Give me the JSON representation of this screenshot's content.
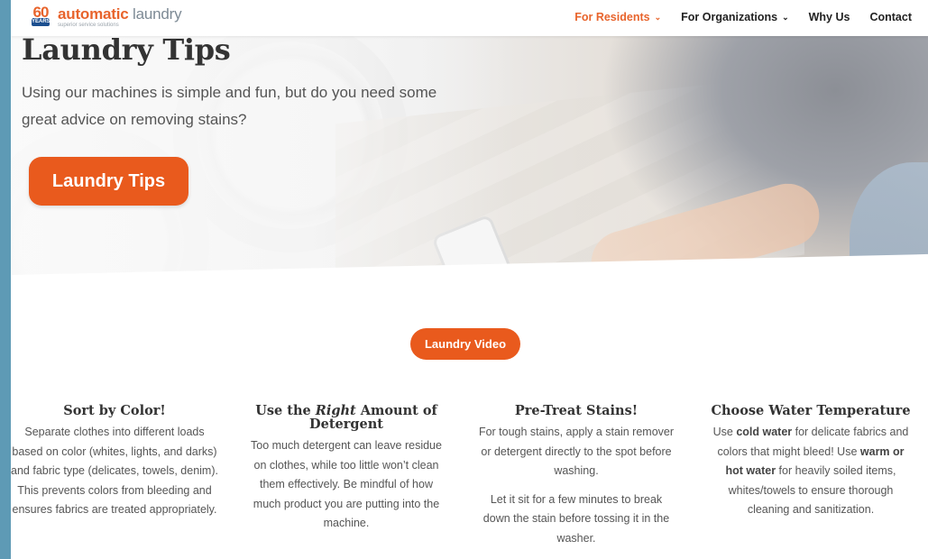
{
  "header": {
    "logo": {
      "badge_number": "60",
      "badge_label": "YEARS",
      "brand_bold": "automatic",
      "brand_light": "laundry",
      "tagline": "superior service solutions"
    },
    "nav": [
      {
        "label": "For Residents",
        "has_dropdown": true,
        "active": true
      },
      {
        "label": "For Organizations",
        "has_dropdown": true,
        "active": false
      },
      {
        "label": "Why Us",
        "has_dropdown": false,
        "active": false
      },
      {
        "label": "Contact",
        "has_dropdown": false,
        "active": false
      }
    ]
  },
  "hero": {
    "title": "Laundry Tips",
    "description": "Using our machines is simple and fun, but do you need some great advice on removing stains?",
    "button_label": "Laundry Tips"
  },
  "video_button_label": "Laundry Video",
  "tips": [
    {
      "title": "Sort by Color!",
      "body": "Separate clothes into different loads based on color (whites, lights, and darks) and fabric type (delicates, towels, denim). This prevents colors from bleeding and ensures fabrics are treated appropriately."
    },
    {
      "title_pre": "Use the ",
      "title_em": "Right",
      "title_post": " Amount of Detergent",
      "body": "Too much detergent can leave residue on clothes, while too little won’t clean them effectively. Be mindful of how much product you are putting into the machine."
    },
    {
      "title": "Pre-Treat Stains!",
      "body": "For tough stains, apply a stain remover or detergent directly to the spot before washing.",
      "body2": "Let it sit for a few minutes to break down the stain before tossing it in the washer."
    },
    {
      "title": "Choose Water Temperature",
      "body_a": "Use ",
      "body_b": "cold water",
      "body_c": " for delicate fabrics and colors that might bleed!  Use ",
      "body_d": "warm or hot water",
      "body_e": " for heavily soiled items, whites/towels to ensure thorough cleaning and sanitization."
    }
  ],
  "colors": {
    "accent": "#e95a1d",
    "brand_orange": "#e8642c",
    "brand_navy": "#1c4f8f",
    "left_strip": "#5e9ab5"
  }
}
